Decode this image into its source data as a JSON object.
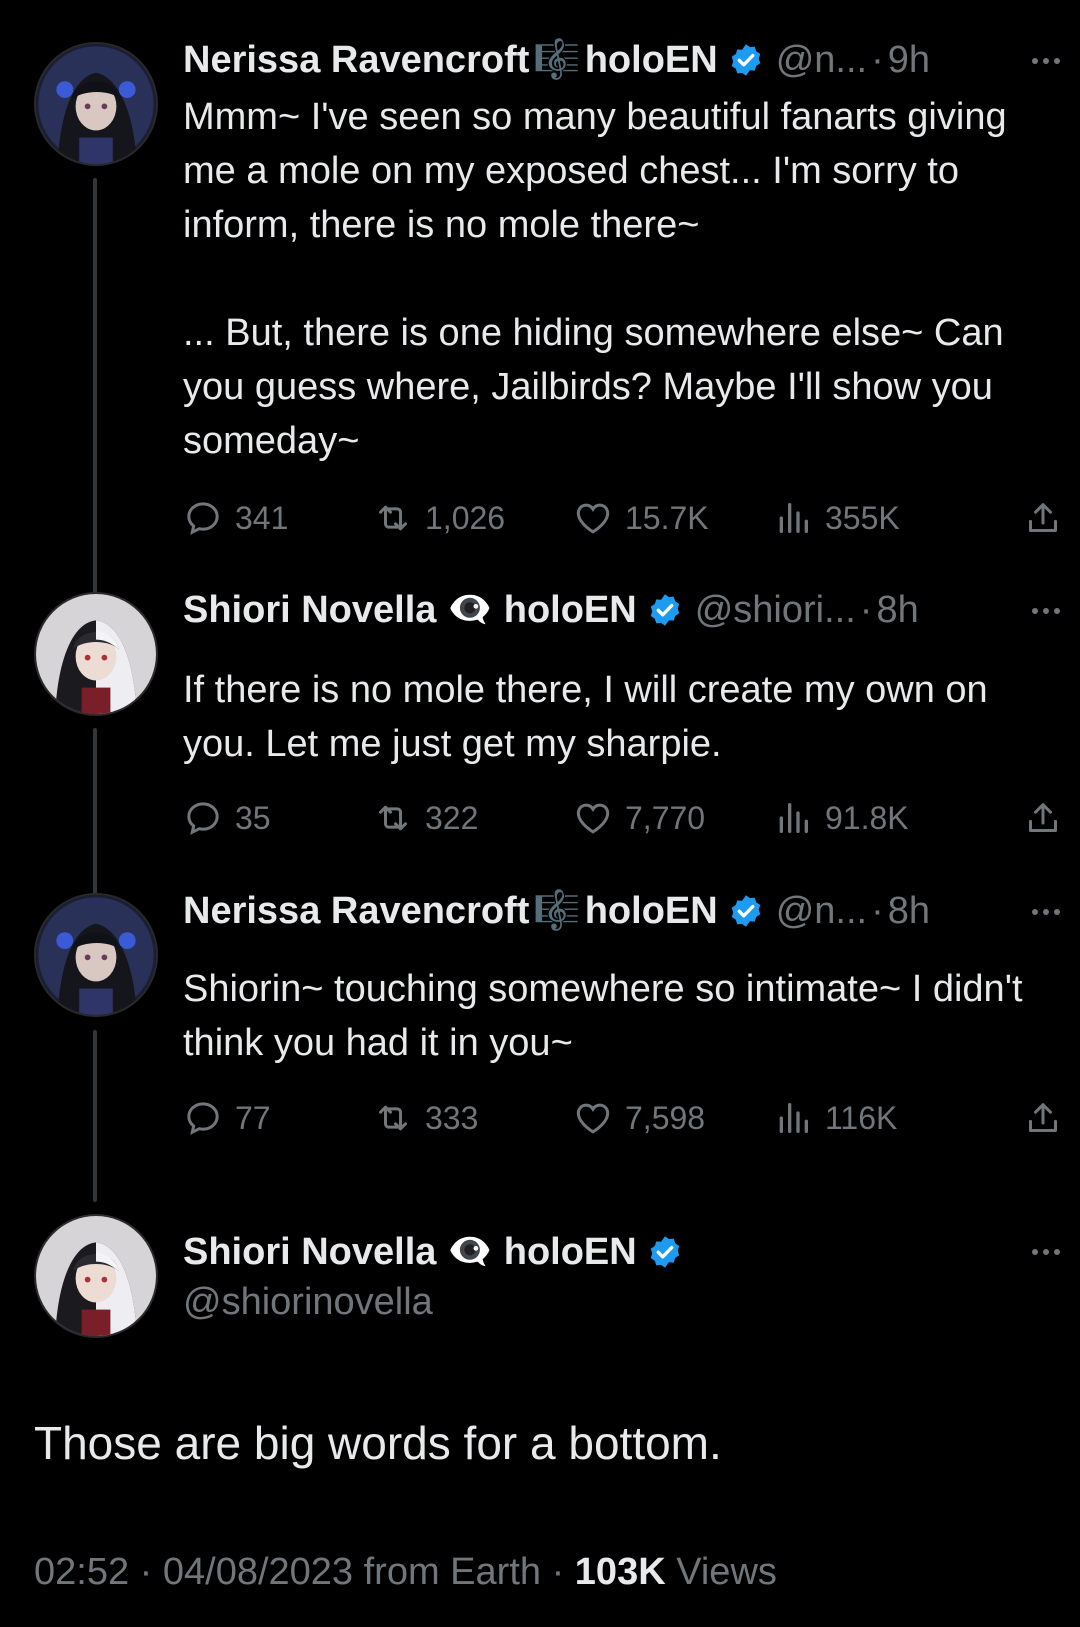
{
  "tweets": [
    {
      "name": "Nerissa Ravencroft",
      "emoji": "🎼",
      "suffix": "holoEN",
      "handle": "@n...",
      "dot": "·",
      "time": "9h",
      "text": "Mmm~ I've seen so many beautiful fanarts giving me a mole on my exposed chest... I'm sorry to inform, there is no mole there~\n\n... But, there is one hiding somewhere else~ Can you guess where, Jailbirds? Maybe I'll show you someday~",
      "replies": "341",
      "retweets": "1,026",
      "likes": "15.7K",
      "views": "355K"
    },
    {
      "name": "Shiori Novella",
      "emoji": "👁‍🗨",
      "suffix": "holoEN",
      "handle": "@shiori...",
      "dot": "·",
      "time": "8h",
      "text": "If there is no mole there, I will create my own on you. Let me just get my sharpie.",
      "replies": "35",
      "retweets": "322",
      "likes": "7,770",
      "views": "91.8K"
    },
    {
      "name": "Nerissa Ravencroft",
      "emoji": "🎼",
      "suffix": "holoEN",
      "handle": "@n...",
      "dot": "·",
      "time": "8h",
      "text": "Shiorin~ touching somewhere so intimate~ I didn't think you had it in you~",
      "replies": "77",
      "retweets": "333",
      "likes": "7,598",
      "views": "116K"
    }
  ],
  "main": {
    "name": "Shiori Novella",
    "emoji": "👁‍🗨",
    "suffix": "holoEN",
    "handle": "@shiorinovella",
    "text": "Those are big words for a bottom.",
    "time": "02:52",
    "date": "04/08/2023",
    "source": "from Earth",
    "views_count": "103K",
    "views_label": "Views",
    "dot": "·"
  },
  "colors": {
    "background": "#000000",
    "text": "#e7e9ea",
    "muted": "#71767b",
    "verified": "#1d9bf0",
    "thread_line": "#333639"
  },
  "icons": [
    "reply-icon",
    "retweet-icon",
    "like-icon",
    "views-icon",
    "share-icon",
    "more-icon",
    "verified-badge-icon"
  ]
}
